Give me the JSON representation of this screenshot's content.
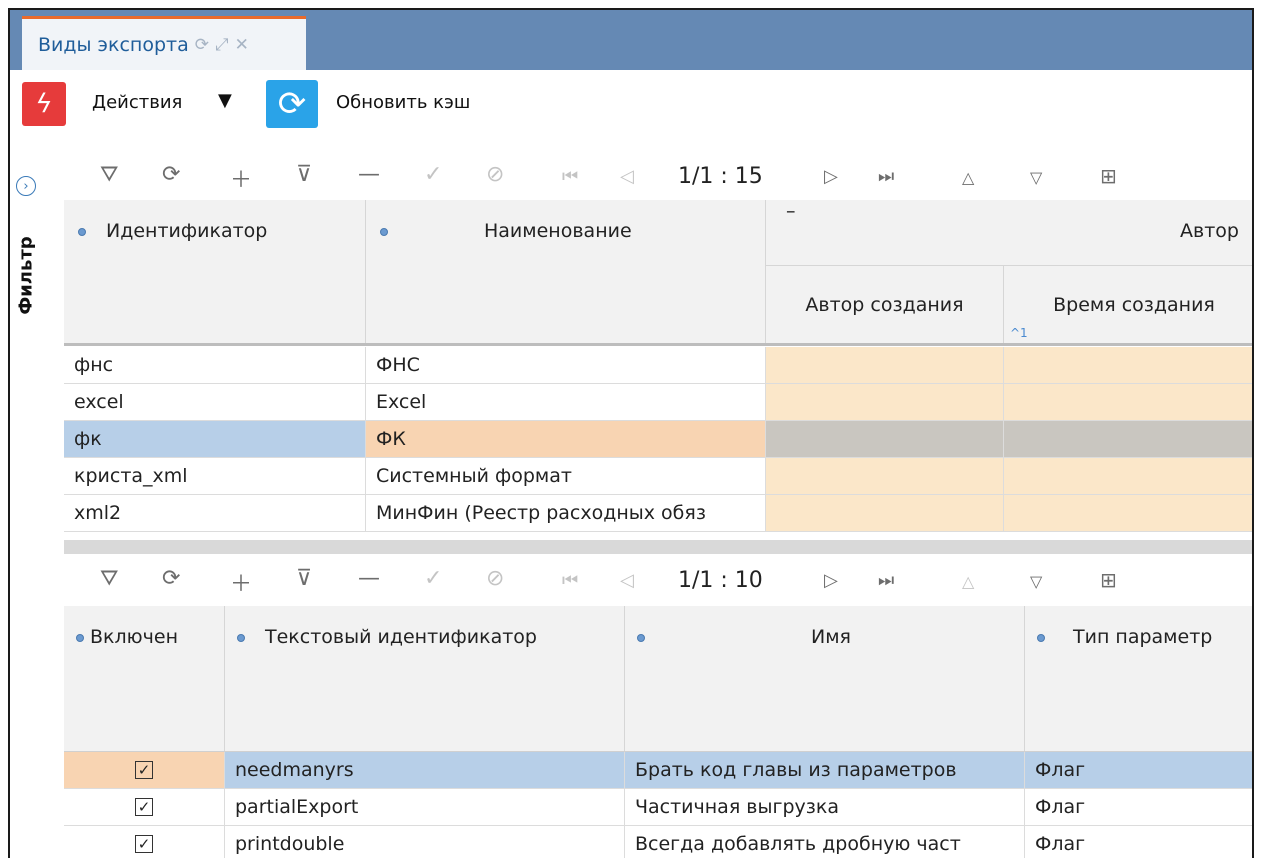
{
  "tab": {
    "title": "Виды экспорта"
  },
  "toolbar": {
    "actions_label": "Действия",
    "actions_arrow": "▼",
    "refresh_label": "Обновить кэш"
  },
  "sidebar": {
    "filter_label": "Фильтр"
  },
  "grid1": {
    "nav": {
      "page_info": "1/1 : 15"
    },
    "headers": {
      "id": "Идентификатор",
      "name": "Наименование",
      "group_minus": "–",
      "group": "Автор",
      "author": "Автор создания",
      "time": "Время создания",
      "sort_marker": "^1"
    },
    "rows": [
      {
        "id": "фнс",
        "name": "ФНС"
      },
      {
        "id": "excel",
        "name": "Excel"
      },
      {
        "id": "фк",
        "name": "ФК"
      },
      {
        "id": "криста_xml",
        "name": "Системный формат"
      },
      {
        "id": "xml2",
        "name": "МинФин (Реестр расходных обяз"
      }
    ]
  },
  "grid2": {
    "nav": {
      "page_info": "1/1 : 10"
    },
    "headers": {
      "enabled": "Включен",
      "text_id": "Текстовый идентификатор",
      "name": "Имя",
      "param_type": "Тип параметр"
    },
    "rows": [
      {
        "checked": "✓",
        "text_id": "needmanyrs",
        "name": "Брать код главы из параметров",
        "type": "Флаг"
      },
      {
        "checked": "✓",
        "text_id": "partialExport",
        "name": "Частичная выгрузка",
        "type": "Флаг"
      },
      {
        "checked": "✓",
        "text_id": "printdouble",
        "name": "Всегда добавлять дробную част",
        "type": "Флаг"
      }
    ]
  },
  "colors": {
    "tabbar": "#6589b4",
    "tab_accent": "#e96b2c",
    "actions_icon": "#e63b3b",
    "refresh_icon": "#2aa3e8",
    "selected_row": "#b7cfe8",
    "selected_cell": "#f8d4b2",
    "author_cell": "#fbe7c9",
    "selected_author_cell": "#c9c6c0"
  }
}
